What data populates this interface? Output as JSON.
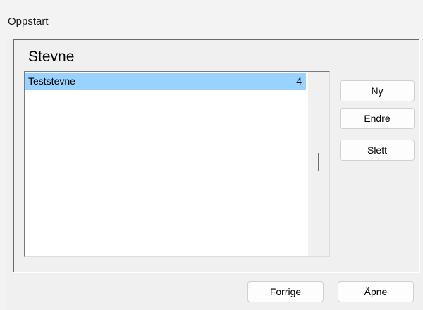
{
  "window": {
    "title": "Oppstart"
  },
  "section": {
    "title": "Stevne"
  },
  "list": {
    "rows": [
      {
        "name": "Teststevne",
        "count": "4",
        "selected": true
      }
    ]
  },
  "side_buttons": {
    "new_label": "Ny",
    "edit_label": "Endre",
    "delete_label": "Slett"
  },
  "footer_buttons": {
    "previous_label": "Forrige",
    "open_label": "Åpne"
  },
  "colors": {
    "selection": "#99d1ff",
    "window_bg": "#f0f0f0"
  }
}
